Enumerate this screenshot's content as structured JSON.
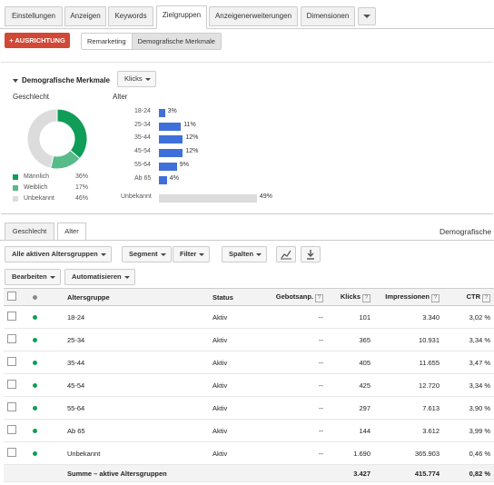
{
  "tabs": [
    "Einstellungen",
    "Anzeigen",
    "Keywords",
    "Zielgruppen",
    "Anzeigenerweiterungen",
    "Dimensionen"
  ],
  "actions": {
    "targeting_label": "+ AUSRICHTUNG",
    "subtabs": [
      "Remarketing",
      "Demografische Merkmale"
    ]
  },
  "panel": {
    "title": "Demografische Merkmale",
    "metric": "Klicks",
    "gender_label": "Geschlecht",
    "age_label": "Alter",
    "gender": [
      {
        "label": "Männlich",
        "value": "36%",
        "pct": 36,
        "color": "#0f9d58"
      },
      {
        "label": "Weiblich",
        "value": "17%",
        "pct": 17,
        "color": "#57bb8a"
      },
      {
        "label": "Unbekannt",
        "value": "46%",
        "pct": 46,
        "color": "#dcdcdc"
      }
    ],
    "age": [
      {
        "label": "18-24",
        "value": "3%",
        "pct": 3
      },
      {
        "label": "25-34",
        "value": "11%",
        "pct": 11
      },
      {
        "label": "35-44",
        "value": "12%",
        "pct": 12
      },
      {
        "label": "45-54",
        "value": "12%",
        "pct": 12
      },
      {
        "label": "55-64",
        "value": "9%",
        "pct": 9
      },
      {
        "label": "Ab 65",
        "value": "4%",
        "pct": 4
      },
      {
        "label": "Unbekannt",
        "value": "49%",
        "pct": 49
      }
    ]
  },
  "lower_tabs": [
    "Geschlecht",
    "Alter"
  ],
  "lower_title": "Demografische",
  "toolbar": {
    "filter_all": "Alle aktiven Altersgruppen",
    "segment": "Segment",
    "filter": "Filter",
    "columns": "Spalten",
    "edit": "Bearbeiten",
    "automate": "Automatisieren",
    "chart_icon": "chart-icon",
    "download_icon": "download-icon"
  },
  "table": {
    "headers": [
      "Altersgruppe",
      "Status",
      "Gebotsanp.",
      "Klicks",
      "Impressionen",
      "CTR"
    ],
    "rows": [
      [
        "18-24",
        "Aktiv",
        "--",
        "101",
        "3.340",
        "3,02 %"
      ],
      [
        "25-34",
        "Aktiv",
        "--",
        "365",
        "10.931",
        "3,34 %"
      ],
      [
        "35-44",
        "Aktiv",
        "--",
        "405",
        "11.655",
        "3,47 %"
      ],
      [
        "45-54",
        "Aktiv",
        "--",
        "425",
        "12.720",
        "3,34 %"
      ],
      [
        "55-64",
        "Aktiv",
        "--",
        "297",
        "7.613",
        "3,90 %"
      ],
      [
        "Ab 65",
        "Aktiv",
        "--",
        "144",
        "3.612",
        "3,99 %"
      ],
      [
        "Unbekannt",
        "Aktiv",
        "--",
        "1.690",
        "365.903",
        "0,46 %"
      ]
    ],
    "total": [
      "Summe – aktive Altersgruppen",
      "",
      "",
      "3.427",
      "415.774",
      "0,82 %"
    ]
  }
}
